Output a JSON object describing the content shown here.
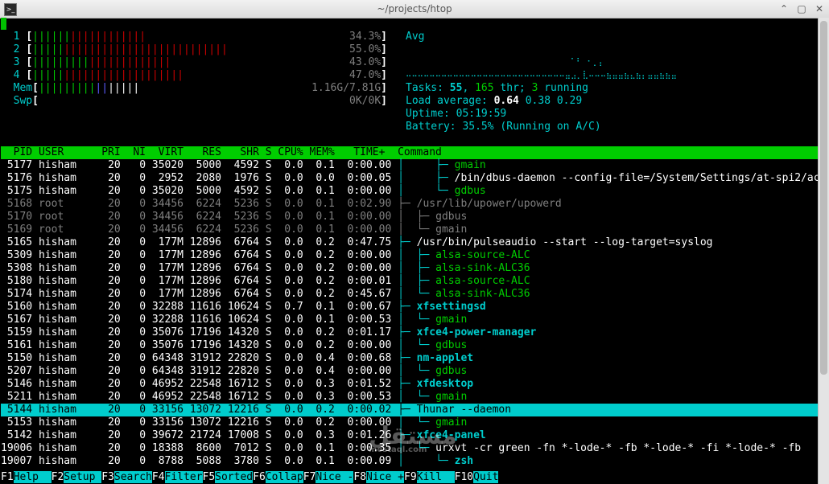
{
  "window": {
    "title": "~/projects/htop",
    "btn_up": "⌃",
    "btn_max": "▢",
    "btn_close": "✕"
  },
  "meters": {
    "cpus": [
      {
        "label": "1",
        "low": "||||||",
        "high": "||||||||||||",
        "pct": "34.3%"
      },
      {
        "label": "2",
        "low": "|||||",
        "high": "||||||||||||||||||||||||||",
        "pct": "55.0%"
      },
      {
        "label": "3",
        "low": "|||||||||",
        "high": "|||||||||||||",
        "pct": "43.0%"
      },
      {
        "label": "4",
        "low": "|||||",
        "high": "|||||||||||||||||||",
        "pct": "47.0%"
      }
    ],
    "mem": {
      "label": "Mem",
      "used": "|||||||||",
      "buffers": "||",
      "cache": "|||||",
      "value": "1.16G/7.81G"
    },
    "swp": {
      "label": "Swp",
      "value": "0K/0K"
    },
    "avg_label": "Avg",
    "graph_top": "                                  ⠁⠃ ⠂⡀⡄",
    "graph_bottom": "⠤⠤⠤⠤⠤⠤⠤⠤⠤⠤⠤⠤⠤⠤⠤⠤⠤⠤⠤⠤⠤⠤⠤⠤⠤⠤⠤⣤⣠⡀⣇⠤⠤⠤⣦⣤⣤⣦⣄⣦⡄⣤⣤⣦⣦⣤",
    "tasks": {
      "label": "Tasks: ",
      "count": "55",
      "sep1": ", ",
      "threads": "165",
      "thr": " thr; ",
      "running": "3",
      "running_label": " running"
    },
    "load": {
      "label": "Load average: ",
      "l1": "0.64",
      "l5": "0.38",
      "l15": "0.29"
    },
    "uptime": {
      "label": "Uptime: ",
      "value": "05:19:59"
    },
    "battery": {
      "label": "Battery: ",
      "value": "35.5% (Running on A/C)"
    }
  },
  "columns": "  PID USER      PRI  NI  VIRT   RES   SHR S CPU% MEM%   TIME+  Command",
  "processes": [
    {
      "pid": "5177",
      "user": "hisham",
      "pri": "20",
      "ni": "0",
      "virt": "35020",
      "res": "5000",
      "shr": "4592",
      "s": "S",
      "cpu": "0.0",
      "mem": "0.1",
      "time": "0:00.00",
      "tree": "   │     ├─ ",
      "cmd": "gmain",
      "cmdstyle": "thread",
      "dim": false
    },
    {
      "pid": "5176",
      "user": "hisham",
      "pri": "20",
      "ni": "0",
      "virt": "2952",
      "res": "2080",
      "shr": "1976",
      "s": "S",
      "cpu": "0.0",
      "mem": "0.0",
      "time": "0:00.05",
      "tree": "   │     ├─ ",
      "cmd": "/bin/dbus-daemon --config-file=/System/Settings/at-spi2/ac",
      "cmdstyle": "dbus",
      "dim": false
    },
    {
      "pid": "5175",
      "user": "hisham",
      "pri": "20",
      "ni": "0",
      "virt": "35020",
      "res": "5000",
      "shr": "4592",
      "s": "S",
      "cpu": "0.0",
      "mem": "0.1",
      "time": "0:00.00",
      "tree": "   │     └─ ",
      "cmd": "gdbus",
      "cmdstyle": "thread",
      "dim": false
    },
    {
      "pid": "5168",
      "user": "root",
      "pri": "20",
      "ni": "0",
      "virt": "34456",
      "res": "6224",
      "shr": "5236",
      "s": "S",
      "cpu": "0.0",
      "mem": "0.1",
      "time": "0:02.90",
      "tree": "   ├─ ",
      "cmd": "/usr/lib/upower/upowerd",
      "cmdstyle": "dim",
      "dim": true
    },
    {
      "pid": "5170",
      "user": "root",
      "pri": "20",
      "ni": "0",
      "virt": "34456",
      "res": "6224",
      "shr": "5236",
      "s": "S",
      "cpu": "0.0",
      "mem": "0.1",
      "time": "0:00.00",
      "tree": "   │  ├─ ",
      "cmd": "gdbus",
      "cmdstyle": "dim",
      "dim": true
    },
    {
      "pid": "5169",
      "user": "root",
      "pri": "20",
      "ni": "0",
      "virt": "34456",
      "res": "6224",
      "shr": "5236",
      "s": "S",
      "cpu": "0.0",
      "mem": "0.1",
      "time": "0:00.00",
      "tree": "   │  └─ ",
      "cmd": "gmain",
      "cmdstyle": "dim",
      "dim": true
    },
    {
      "pid": "5165",
      "user": "hisham",
      "pri": "20",
      "ni": "0",
      "virt": "177M",
      "res": "12896",
      "shr": "6764",
      "s": "S",
      "cpu": "0.0",
      "mem": "0.2",
      "time": "0:47.75",
      "tree": "   ├─ ",
      "cmd": "/usr/bin/pulseaudio --start --log-target=syslog",
      "cmdstyle": "pulse",
      "dim": false
    },
    {
      "pid": "5309",
      "user": "hisham",
      "pri": "20",
      "ni": "0",
      "virt": "177M",
      "res": "12896",
      "shr": "6764",
      "s": "S",
      "cpu": "0.0",
      "mem": "0.2",
      "time": "0:00.00",
      "tree": "   │  ├─ ",
      "cmd": "alsa-source-ALC",
      "cmdstyle": "thread",
      "dim": false
    },
    {
      "pid": "5308",
      "user": "hisham",
      "pri": "20",
      "ni": "0",
      "virt": "177M",
      "res": "12896",
      "shr": "6764",
      "s": "S",
      "cpu": "0.0",
      "mem": "0.2",
      "time": "0:00.00",
      "tree": "   │  ├─ ",
      "cmd": "alsa-sink-ALC36",
      "cmdstyle": "thread",
      "dim": false
    },
    {
      "pid": "5180",
      "user": "hisham",
      "pri": "20",
      "ni": "0",
      "virt": "177M",
      "res": "12896",
      "shr": "6764",
      "s": "S",
      "cpu": "0.0",
      "mem": "0.2",
      "time": "0:00.01",
      "tree": "   │  ├─ ",
      "cmd": "alsa-source-ALC",
      "cmdstyle": "thread",
      "dim": false
    },
    {
      "pid": "5174",
      "user": "hisham",
      "pri": "20",
      "ni": "0",
      "virt": "177M",
      "res": "12896",
      "shr": "6764",
      "s": "S",
      "cpu": "0.0",
      "mem": "0.2",
      "time": "0:45.67",
      "tree": "   │  └─ ",
      "cmd": "alsa-sink-ALC36",
      "cmdstyle": "thread",
      "dim": false
    },
    {
      "pid": "5160",
      "user": "hisham",
      "pri": "20",
      "ni": "0",
      "virt": "32288",
      "res": "11616",
      "shr": "10624",
      "s": "S",
      "cpu": "0.7",
      "mem": "0.1",
      "time": "0:00.67",
      "tree": "   ├─ ",
      "cmd": "xfsettingsd",
      "cmdstyle": "proc",
      "dim": false
    },
    {
      "pid": "5167",
      "user": "hisham",
      "pri": "20",
      "ni": "0",
      "virt": "32288",
      "res": "11616",
      "shr": "10624",
      "s": "S",
      "cpu": "0.0",
      "mem": "0.1",
      "time": "0:00.53",
      "tree": "   │  └─ ",
      "cmd": "gmain",
      "cmdstyle": "thread",
      "dim": false
    },
    {
      "pid": "5159",
      "user": "hisham",
      "pri": "20",
      "ni": "0",
      "virt": "35076",
      "res": "17196",
      "shr": "14320",
      "s": "S",
      "cpu": "0.0",
      "mem": "0.2",
      "time": "0:01.17",
      "tree": "   ├─ ",
      "cmd": "xfce4-power-manager",
      "cmdstyle": "proc",
      "dim": false
    },
    {
      "pid": "5161",
      "user": "hisham",
      "pri": "20",
      "ni": "0",
      "virt": "35076",
      "res": "17196",
      "shr": "14320",
      "s": "S",
      "cpu": "0.0",
      "mem": "0.2",
      "time": "0:00.00",
      "tree": "   │  └─ ",
      "cmd": "gdbus",
      "cmdstyle": "thread",
      "dim": false
    },
    {
      "pid": "5150",
      "user": "hisham",
      "pri": "20",
      "ni": "0",
      "virt": "64348",
      "res": "31912",
      "shr": "22820",
      "s": "S",
      "cpu": "0.0",
      "mem": "0.4",
      "time": "0:00.68",
      "tree": "   ├─ ",
      "cmd": "nm-applet",
      "cmdstyle": "proc",
      "dim": false
    },
    {
      "pid": "5207",
      "user": "hisham",
      "pri": "20",
      "ni": "0",
      "virt": "64348",
      "res": "31912",
      "shr": "22820",
      "s": "S",
      "cpu": "0.0",
      "mem": "0.4",
      "time": "0:00.00",
      "tree": "   │  └─ ",
      "cmd": "gdbus",
      "cmdstyle": "thread",
      "dim": false
    },
    {
      "pid": "5146",
      "user": "hisham",
      "pri": "20",
      "ni": "0",
      "virt": "46952",
      "res": "22548",
      "shr": "16712",
      "s": "S",
      "cpu": "0.0",
      "mem": "0.3",
      "time": "0:01.52",
      "tree": "   ├─ ",
      "cmd": "xfdesktop",
      "cmdstyle": "proc",
      "dim": false
    },
    {
      "pid": "5211",
      "user": "hisham",
      "pri": "20",
      "ni": "0",
      "virt": "46952",
      "res": "22548",
      "shr": "16712",
      "s": "S",
      "cpu": "0.0",
      "mem": "0.3",
      "time": "0:00.53",
      "tree": "   │  └─ ",
      "cmd": "gmain",
      "cmdstyle": "thread",
      "dim": false
    },
    {
      "pid": "5144",
      "user": "hisham",
      "pri": "20",
      "ni": "0",
      "virt": "33156",
      "res": "13072",
      "shr": "12216",
      "s": "S",
      "cpu": "0.0",
      "mem": "0.2",
      "time": "0:00.02",
      "tree": "   ├─ ",
      "cmd": "Thunar --daemon",
      "cmdstyle": "sel",
      "dim": false,
      "selected": true
    },
    {
      "pid": "5153",
      "user": "hisham",
      "pri": "20",
      "ni": "0",
      "virt": "33156",
      "res": "13072",
      "shr": "12216",
      "s": "S",
      "cpu": "0.0",
      "mem": "0.2",
      "time": "0:00.00",
      "tree": "   │  └─ ",
      "cmd": "gmain",
      "cmdstyle": "thread",
      "dim": false
    },
    {
      "pid": "5142",
      "user": "hisham",
      "pri": "20",
      "ni": "0",
      "virt": "39672",
      "res": "21724",
      "shr": "17008",
      "s": "S",
      "cpu": "0.0",
      "mem": "0.3",
      "time": "0:01.26",
      "tree": "   ├─ ",
      "cmd": "xfce4-panel",
      "cmdstyle": "proc",
      "dim": false
    },
    {
      "pid": "19006",
      "user": "hisham",
      "pri": "20",
      "ni": "0",
      "virt": "18388",
      "res": "8600",
      "shr": "7012",
      "s": "S",
      "cpu": "0.0",
      "mem": "0.1",
      "time": "0:00.35",
      "tree": "   │  └─ ",
      "cmd": "urxvt -cr green -fn *-lode-* -fb *-lode-* -fi *-lode-* -fb",
      "cmdstyle": "plain",
      "dim": false
    },
    {
      "pid": "19007",
      "user": "hisham",
      "pri": "20",
      "ni": "0",
      "virt": "8788",
      "res": "5088",
      "shr": "3780",
      "s": "S",
      "cpu": "0.0",
      "mem": "0.1",
      "time": "0:00.09",
      "tree": "   │     └─ ",
      "cmd": "zsh",
      "cmdstyle": "proc",
      "dim": false
    }
  ],
  "footer": [
    {
      "key": "F1",
      "label": "Help  "
    },
    {
      "key": "F2",
      "label": "Setup "
    },
    {
      "key": "F3",
      "label": "Search"
    },
    {
      "key": "F4",
      "label": "Filter"
    },
    {
      "key": "F5",
      "label": "Sorted"
    },
    {
      "key": "F6",
      "label": "Collap"
    },
    {
      "key": "F7",
      "label": "Nice -"
    },
    {
      "key": "F8",
      "label": "Nice +"
    },
    {
      "key": "F9",
      "label": "Kill  "
    },
    {
      "key": "F10",
      "label": "Quit"
    }
  ],
  "watermark": {
    "main": "مستقل",
    "sub": "mostaql.com"
  }
}
